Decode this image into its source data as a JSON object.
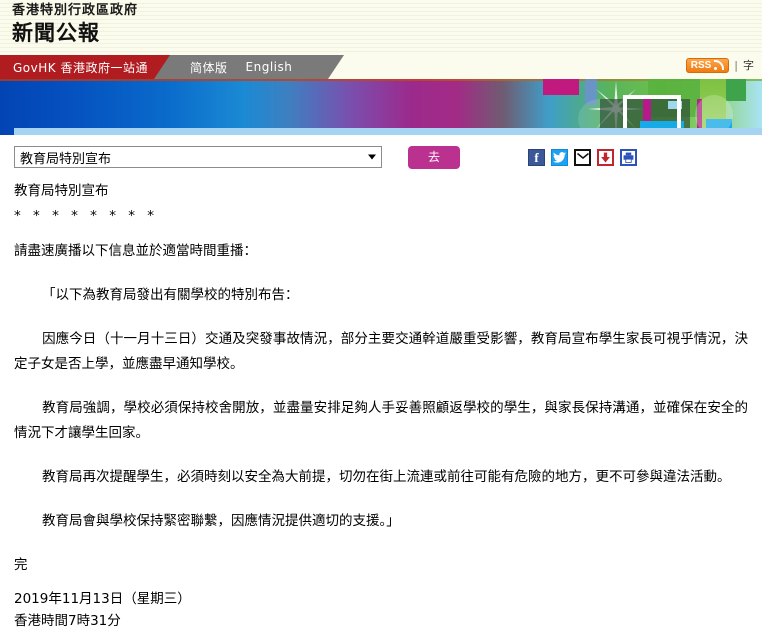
{
  "header": {
    "org_name": "香港特別行政區政府",
    "site_name": "新聞公報",
    "rss_label": "RSS",
    "tool_separator": "|",
    "font_size_label": "字"
  },
  "nav": {
    "primary_tab": "GovHK 香港政府一站通",
    "links": [
      {
        "label": "简体版"
      },
      {
        "label": "English"
      }
    ]
  },
  "controls": {
    "topic_selected": "教育局特別宣布",
    "go_label": "去",
    "facebook_glyph": "f",
    "social": [
      {
        "name": "facebook"
      },
      {
        "name": "twitter"
      },
      {
        "name": "email"
      },
      {
        "name": "download"
      },
      {
        "name": "print"
      }
    ]
  },
  "article": {
    "title": "教育局特別宣布",
    "stars": "* * * * * * * *",
    "lead": "請盡速廣播以下信息並於適當時間重播：",
    "paragraphs": [
      "「以下為教育局發出有關學校的特別布告：",
      "因應今日（十一月十三日）交通及突發事故情況，部分主要交通幹道嚴重受影響，教育局宣布學生家長可視乎情況，決定子女是否上學，並應盡早通知學校。",
      "教育局強調，學校必須保持校舍開放，並盡量安排足夠人手妥善照顧返學校的學生，與家長保持溝通，並確保在安全的情況下才讓學生回家。",
      "教育局再次提醒學生，必須時刻以安全為大前提，切勿在街上流連或前往可能有危險的地方，更不可參與違法活動。",
      "教育局會與學校保持緊密聯繫，因應情況提供適切的支援。」"
    ],
    "end_mark": "完",
    "date_line": "2019年11月13日（星期三）",
    "time_line": "香港時間7時31分"
  },
  "colors": {
    "nav_active": "#b01c20",
    "nav_bar": "#7a7a7a",
    "go_button": "#bb3190",
    "rss_orange": "#ee7b10",
    "header_bg": "#fbfbee",
    "banner_strip": "#a5d4f2"
  }
}
